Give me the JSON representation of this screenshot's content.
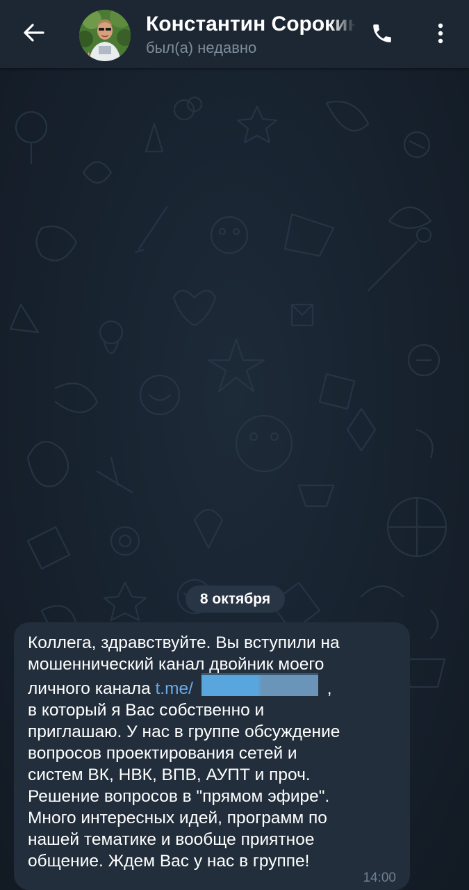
{
  "header": {
    "back_icon": "arrow-left-icon",
    "contact_name": "Константин Сорокин",
    "status": "был(а) недавно",
    "call_icon": "phone-icon",
    "menu_icon": "more-vertical-icon"
  },
  "chat": {
    "date_separator": "8 октября",
    "message": {
      "line1": "Коллега, здравствуйте. Вы вступили на\nмошеннический канал двойник моего\nличного канала ",
      "link": "t.me/",
      "after_link": " ,\n",
      "line2": "в который я Вас собственно и\nприглашаю. У нас в группе обсуждение\nвопросов проектирования сетей и\nсистем ВК, НВК, ВПВ, АУПТ и проч.\nРешение вопросов в \"прямом эфире\".\nМного интересных идей, программ по\nнашей тематике и вообще приятное\nобщение. Ждем Вас у нас в группе!",
      "time": "14:00"
    }
  },
  "colors": {
    "header_bg": "#1c2733",
    "bubble_bg": "#222e3b",
    "link": "#6aaae8",
    "status": "#7e8c9b"
  }
}
